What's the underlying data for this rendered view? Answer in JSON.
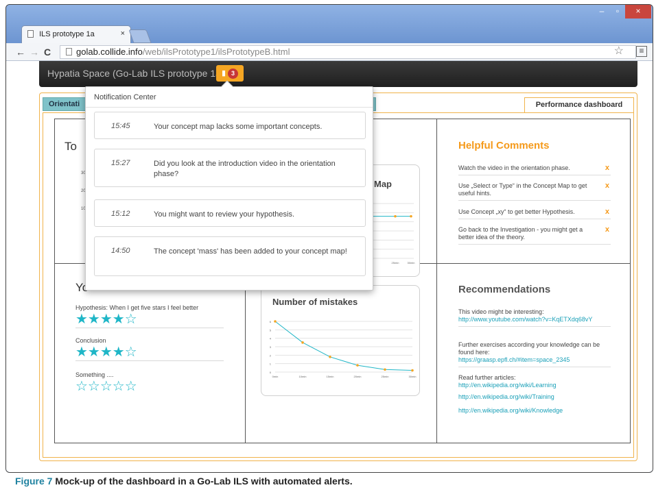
{
  "browser": {
    "tab_title": "ILS prototype 1a",
    "tab_close": "×",
    "back": "←",
    "forward": "→",
    "reload": "C",
    "url_host": "golab.collide.info",
    "url_path": "/web/ilsPrototype1/ilsPrototypeB.html",
    "star": "☆",
    "menu": "≡",
    "win_min": "–",
    "win_max": "▫",
    "win_close": "×"
  },
  "app": {
    "title": "Hypatia Space (Go-Lab ILS prototype 1a)",
    "notification_icon": "bell-icon",
    "notification_count": "3",
    "bell_glyph": "▮",
    "accent_color": "#f5a623"
  },
  "workspace": {
    "tab_left": "Orientati",
    "tab_right": "Performance dashboard"
  },
  "notifications": {
    "header": "Notification Center",
    "items": [
      {
        "time": "15:45",
        "message": "Your concept map lacks some important concepts."
      },
      {
        "time": "15:27",
        "message": "Did you look at the introduction video in the orientation phase?"
      },
      {
        "time": "15:12",
        "message": "You might want to review your hypothesis."
      },
      {
        "time": "14:50",
        "message": "The concept 'mass' has been added to your concept map!"
      }
    ]
  },
  "dashboard": {
    "top_left_title": "To",
    "top_left_ticks": [
      "30",
      "20",
      "10"
    ],
    "top_chart_title_fragment": "Map",
    "top_chart_x_ticks": [
      "25min",
      "30min"
    ],
    "bottom_left_title": "Yo",
    "ratings": [
      {
        "label": "Hypothesis: When I get five stars I feel better",
        "stars": "★★★★☆",
        "filled": 4
      },
      {
        "label": "Conclusion",
        "stars": "★★★★☆",
        "filled": 4
      },
      {
        "label": "Something ....",
        "stars": "☆☆☆☆☆",
        "filled": 0
      }
    ],
    "mistakes_title": "Number of mistakes",
    "help_title": "Helpful Comments",
    "help_items": [
      {
        "text": "Watch the video in the orientation phase.",
        "close": "x"
      },
      {
        "text": "Use „Select or Type“ in the Concept Map to get useful hints.",
        "close": "x"
      },
      {
        "text": "Use Concept „xy“ to get better Hypothesis.",
        "close": "x"
      },
      {
        "text": "Go back to the Investigation - you might get a better idea of the theory.",
        "close": "x"
      }
    ],
    "rec_title": "Recommendations",
    "recommendations": [
      {
        "text": "This video might be interesting:",
        "link": "http://www.youtube.com/watch?v=KqETXdq68vY"
      },
      {
        "text": "Further exercises according your knowledge can be found here:",
        "link": "https://graasp.epfl.ch/#item=space_2345"
      },
      {
        "text": "Read further articles:",
        "link": "http://en.wikipedia.org/wiki/Learning"
      },
      {
        "text": "",
        "link": "http://en.wikipedia.org/wiki/Training"
      },
      {
        "text": "",
        "link": "http://en.wikipedia.org/wiki/Knowledge"
      }
    ]
  },
  "chart_data": [
    {
      "type": "line",
      "title": "Number of mistakes",
      "x": [
        "0min",
        "10min",
        "15min",
        "20min",
        "25min",
        "30min"
      ],
      "series": [
        {
          "values": [
            6,
            3.5,
            1.8,
            0.8,
            0.3,
            0.2
          ]
        }
      ],
      "y_ticks": [
        "0",
        "1",
        "2",
        "3",
        "4",
        "5",
        "6"
      ],
      "ylim": [
        0,
        6
      ],
      "color": "#1fb6c7",
      "marker_color": "#f5a623"
    },
    {
      "type": "line",
      "title": "Map",
      "x": [
        "25min",
        "30min"
      ],
      "series": [
        {
          "values": [
            4.6,
            4.6
          ]
        }
      ],
      "ylim": [
        0,
        6
      ],
      "color": "#1fb6c7",
      "marker_color": "#f5a623"
    }
  ],
  "caption": {
    "figure": "Figure 7",
    "text": " Mock-up of the dashboard in a Go-Lab ILS with automated alerts."
  }
}
